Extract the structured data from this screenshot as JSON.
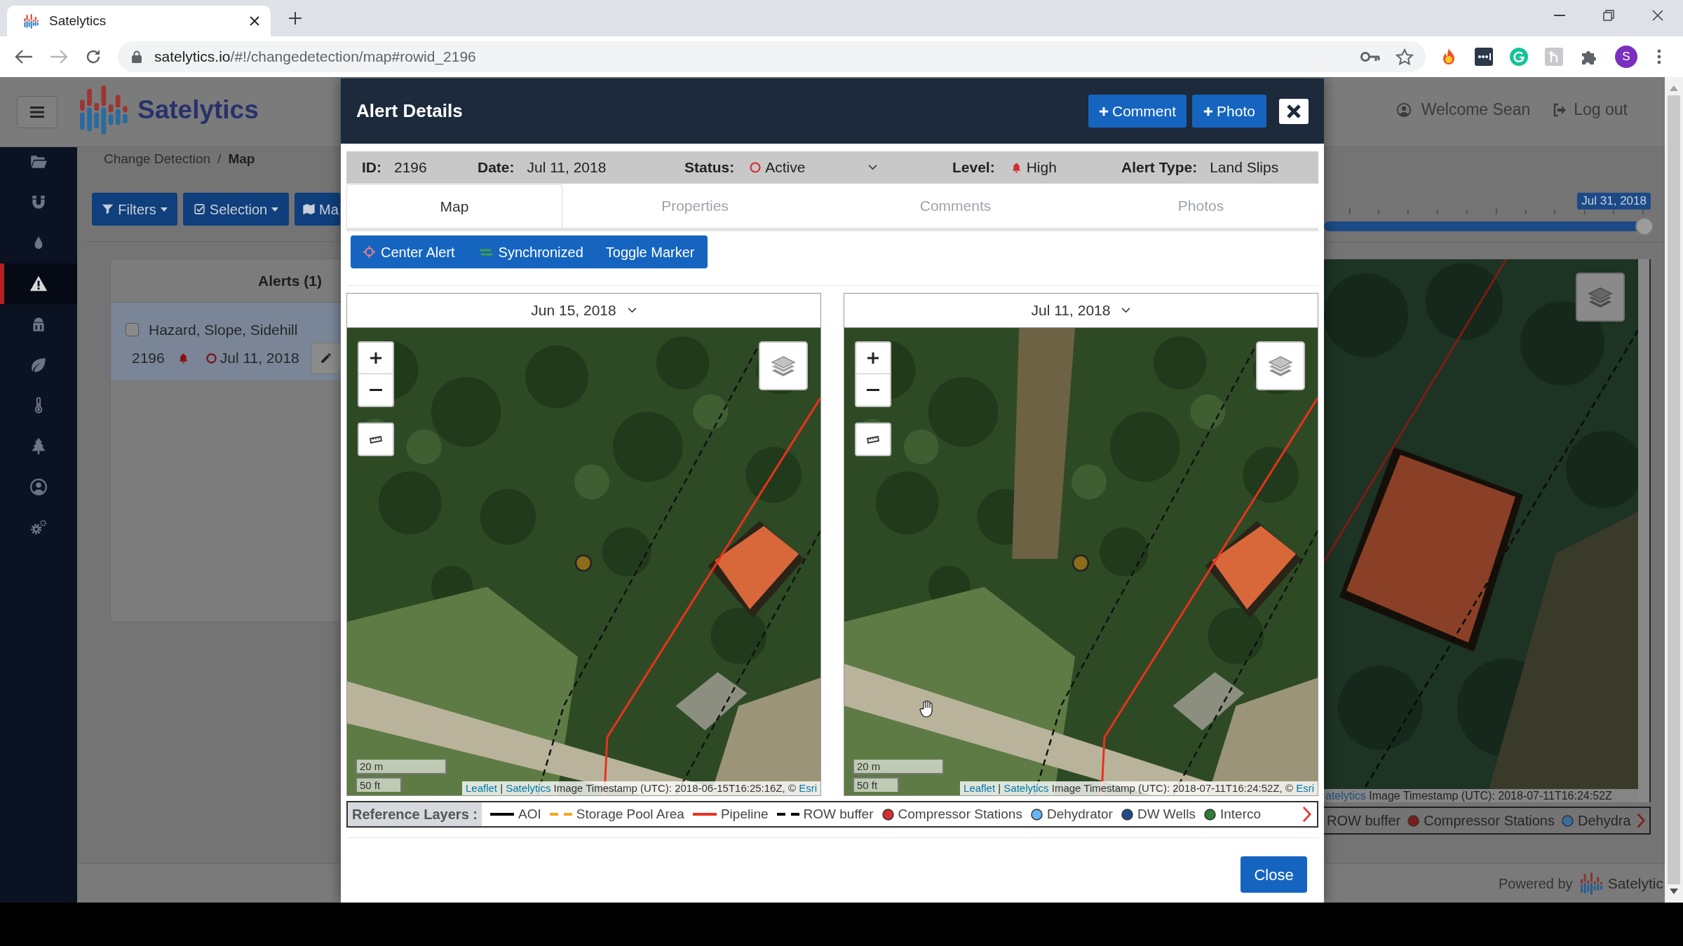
{
  "browser": {
    "tab": {
      "title": "Satelytics",
      "selected": true
    },
    "url": {
      "host": "satelytics.io",
      "path": "/#!/changedetection/map#rowid_2196"
    },
    "profile": {
      "initial": "S"
    }
  },
  "app": {
    "brand": "Satelytics",
    "user": {
      "welcome": "Welcome Sean",
      "logout": "Log out"
    },
    "sidebar": {
      "items": [
        {
          "selected": false
        },
        {
          "selected": false
        },
        {
          "selected": false
        },
        {
          "selected": true
        },
        {
          "selected": false
        },
        {
          "selected": false
        },
        {
          "selected": false
        },
        {
          "selected": false
        },
        {
          "selected": false
        },
        {
          "selected": false
        }
      ]
    },
    "breadcrumb": {
      "separator": "/",
      "items": [
        {
          "label": "Change Detection",
          "current": false
        },
        {
          "label": "Map",
          "current": true
        }
      ]
    },
    "toolbar": [
      {
        "label": "Filters",
        "dropdown": true
      },
      {
        "label": "Selection",
        "dropdown": true
      },
      {
        "label": "Ma"
      }
    ],
    "alerts": {
      "title": "Alerts (1)",
      "items": [
        {
          "title": "Hazard, Slope, Sidehill",
          "id": "2196",
          "date": "Jul 11, 2018",
          "checked": false,
          "selected": true
        }
      ]
    },
    "timeline": {
      "date": "Jul 31, 2018",
      "level": 1
    },
    "background_map": {
      "attribution": {
        "provider": "atelytics",
        "timestamp": "Image Timestamp (UTC): 2018-07-11T16:24:52Z"
      },
      "legend": [
        {
          "label": "ROW buffer",
          "kind": "label"
        },
        {
          "label": "Compressor Stations",
          "kind": "dot",
          "color": "#7a1d17"
        },
        {
          "label": "Dehydra",
          "kind": "dot",
          "color": "#3c6c9a"
        }
      ]
    },
    "footer": {
      "powered_by": "Powered by",
      "brand": "Satelytic"
    }
  },
  "modal": {
    "title": "Alert Details",
    "actions": [
      {
        "label": "Comment"
      },
      {
        "label": "Photo"
      }
    ],
    "fields": [
      {
        "label": "ID:",
        "value": "2196",
        "kind": "text"
      },
      {
        "label": "Date:",
        "value": "Jul 11, 2018",
        "kind": "text"
      },
      {
        "label": "Status:",
        "value": "Active",
        "kind": "status"
      },
      {
        "label": "Level:",
        "value": "High",
        "kind": "level"
      },
      {
        "label": "Alert Type:",
        "value": "Land Slips",
        "kind": "text"
      }
    ],
    "tabs": [
      {
        "label": "Map",
        "selected": true
      },
      {
        "label": "Properties",
        "selected": false
      },
      {
        "label": "Comments",
        "selected": false
      },
      {
        "label": "Photos",
        "selected": false
      }
    ],
    "map_tools": [
      {
        "label": "Center Alert"
      },
      {
        "label": "Synchronized"
      },
      {
        "label": "Toggle Marker"
      }
    ],
    "maps": [
      {
        "date": "Jun 15, 2018",
        "scale": [
          "20 m",
          "50 ft"
        ],
        "attribution": {
          "leaflet": "Leaflet",
          "separator": "|",
          "provider": "Satelytics",
          "timestamp": "Image Timestamp (UTC): 2018-06-15T16:25:16Z, ©",
          "source": "Esri"
        }
      },
      {
        "date": "Jul 11, 2018",
        "scale": [
          "20 m",
          "50 ft"
        ],
        "attribution": {
          "leaflet": "Leaflet",
          "separator": "|",
          "provider": "Satelytics",
          "timestamp": "Image Timestamp (UTC): 2018-07-11T16:24:52Z, ©",
          "source": "Esri"
        }
      }
    ],
    "legend": {
      "title": "Reference Layers :",
      "items": [
        {
          "label": "AOI",
          "kind": "line",
          "color": "#000000"
        },
        {
          "label": "Storage Pool Area",
          "kind": "dashed",
          "color": "#f5a623"
        },
        {
          "label": "Pipeline",
          "kind": "line",
          "color": "#e8321e"
        },
        {
          "label": "ROW buffer",
          "kind": "dashed",
          "color": "#000000"
        },
        {
          "label": "Compressor Stations",
          "kind": "dot",
          "color": "#d32f2f"
        },
        {
          "label": "Dehydrator",
          "kind": "dot",
          "color": "#64b5f6"
        },
        {
          "label": "DW Wells",
          "kind": "dot",
          "color": "#1e4d8c"
        },
        {
          "label": "Interco",
          "kind": "dot",
          "color": "#2e7d32"
        }
      ]
    },
    "close": "Close"
  }
}
